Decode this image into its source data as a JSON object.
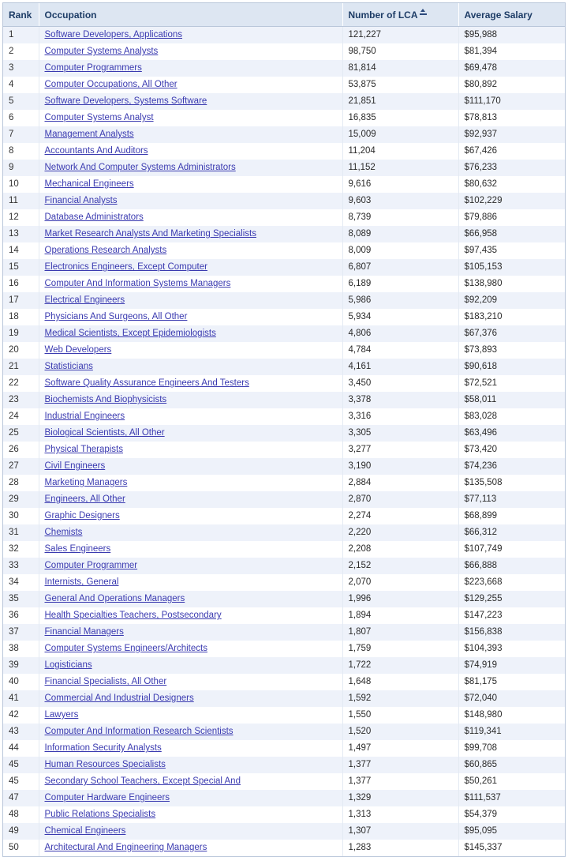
{
  "table": {
    "columns": [
      {
        "key": "rank",
        "label": "Rank",
        "sort_icon": null
      },
      {
        "key": "occ",
        "label": "Occupation",
        "sort_icon": null
      },
      {
        "key": "lca",
        "label": "Number of LCA",
        "sort_icon": "sort-ascending-icon"
      },
      {
        "key": "salary",
        "label": "Average Salary",
        "sort_icon": null
      }
    ],
    "sorted_by": "Number of LCA",
    "sort_direction": "descending",
    "colors": {
      "header_background": "#dde6f2",
      "header_text": "#1d3c66",
      "row_odd_background": "#eef2fa",
      "row_even_background": "#ffffff",
      "link": "#3a3ab0",
      "border": "#b9c6da"
    },
    "rows": [
      {
        "rank": "1",
        "occupation": "Software Developers, Applications",
        "lca": "121,227",
        "salary": "$95,988"
      },
      {
        "rank": "2",
        "occupation": "Computer Systems Analysts",
        "lca": "98,750",
        "salary": "$81,394"
      },
      {
        "rank": "3",
        "occupation": "Computer Programmers",
        "lca": "81,814",
        "salary": "$69,478"
      },
      {
        "rank": "4",
        "occupation": "Computer Occupations, All Other",
        "lca": "53,875",
        "salary": "$80,892"
      },
      {
        "rank": "5",
        "occupation": "Software Developers, Systems Software",
        "lca": "21,851",
        "salary": "$111,170"
      },
      {
        "rank": "6",
        "occupation": "Computer Systems Analyst",
        "lca": "16,835",
        "salary": "$78,813"
      },
      {
        "rank": "7",
        "occupation": "Management Analysts",
        "lca": "15,009",
        "salary": "$92,937"
      },
      {
        "rank": "8",
        "occupation": "Accountants And Auditors",
        "lca": "11,204",
        "salary": "$67,426"
      },
      {
        "rank": "9",
        "occupation": "Network And Computer Systems Administrators",
        "lca": "11,152",
        "salary": "$76,233"
      },
      {
        "rank": "10",
        "occupation": "Mechanical Engineers",
        "lca": "9,616",
        "salary": "$80,632"
      },
      {
        "rank": "11",
        "occupation": "Financial Analysts",
        "lca": "9,603",
        "salary": "$102,229"
      },
      {
        "rank": "12",
        "occupation": "Database Administrators",
        "lca": "8,739",
        "salary": "$79,886"
      },
      {
        "rank": "13",
        "occupation": "Market Research Analysts And Marketing Specialists",
        "lca": "8,089",
        "salary": "$66,958"
      },
      {
        "rank": "14",
        "occupation": "Operations Research Analysts",
        "lca": "8,009",
        "salary": "$97,435"
      },
      {
        "rank": "15",
        "occupation": "Electronics Engineers, Except Computer",
        "lca": "6,807",
        "salary": "$105,153"
      },
      {
        "rank": "16",
        "occupation": "Computer And Information Systems Managers",
        "lca": "6,189",
        "salary": "$138,980"
      },
      {
        "rank": "17",
        "occupation": "Electrical Engineers",
        "lca": "5,986",
        "salary": "$92,209"
      },
      {
        "rank": "18",
        "occupation": "Physicians And Surgeons, All Other",
        "lca": "5,934",
        "salary": "$183,210"
      },
      {
        "rank": "19",
        "occupation": "Medical Scientists, Except Epidemiologists",
        "lca": "4,806",
        "salary": "$67,376"
      },
      {
        "rank": "20",
        "occupation": "Web Developers",
        "lca": "4,784",
        "salary": "$73,893"
      },
      {
        "rank": "21",
        "occupation": "Statisticians",
        "lca": "4,161",
        "salary": "$90,618"
      },
      {
        "rank": "22",
        "occupation": "Software Quality Assurance Engineers And Testers",
        "lca": "3,450",
        "salary": "$72,521"
      },
      {
        "rank": "23",
        "occupation": "Biochemists And Biophysicists",
        "lca": "3,378",
        "salary": "$58,011"
      },
      {
        "rank": "24",
        "occupation": "Industrial Engineers",
        "lca": "3,316",
        "salary": "$83,028"
      },
      {
        "rank": "25",
        "occupation": "Biological Scientists, All Other",
        "lca": "3,305",
        "salary": "$63,496"
      },
      {
        "rank": "26",
        "occupation": "Physical Therapists",
        "lca": "3,277",
        "salary": "$73,420"
      },
      {
        "rank": "27",
        "occupation": "Civil Engineers",
        "lca": "3,190",
        "salary": "$74,236"
      },
      {
        "rank": "28",
        "occupation": "Marketing Managers",
        "lca": "2,884",
        "salary": "$135,508"
      },
      {
        "rank": "29",
        "occupation": "Engineers, All Other",
        "lca": "2,870",
        "salary": "$77,113"
      },
      {
        "rank": "30",
        "occupation": "Graphic Designers",
        "lca": "2,274",
        "salary": "$68,899"
      },
      {
        "rank": "31",
        "occupation": "Chemists",
        "lca": "2,220",
        "salary": "$66,312"
      },
      {
        "rank": "32",
        "occupation": "Sales Engineers",
        "lca": "2,208",
        "salary": "$107,749"
      },
      {
        "rank": "33",
        "occupation": "Computer Programmer",
        "lca": "2,152",
        "salary": "$66,888"
      },
      {
        "rank": "34",
        "occupation": "Internists, General",
        "lca": "2,070",
        "salary": "$223,668"
      },
      {
        "rank": "35",
        "occupation": "General And Operations Managers",
        "lca": "1,996",
        "salary": "$129,255"
      },
      {
        "rank": "36",
        "occupation": "Health Specialties Teachers, Postsecondary",
        "lca": "1,894",
        "salary": "$147,223"
      },
      {
        "rank": "37",
        "occupation": "Financial Managers",
        "lca": "1,807",
        "salary": "$156,838"
      },
      {
        "rank": "38",
        "occupation": "Computer Systems Engineers/Architects",
        "lca": "1,759",
        "salary": "$104,393"
      },
      {
        "rank": "39",
        "occupation": "Logisticians",
        "lca": "1,722",
        "salary": "$74,919"
      },
      {
        "rank": "40",
        "occupation": "Financial Specialists, All Other",
        "lca": "1,648",
        "salary": "$81,175"
      },
      {
        "rank": "41",
        "occupation": "Commercial And Industrial Designers",
        "lca": "1,592",
        "salary": "$72,040"
      },
      {
        "rank": "42",
        "occupation": "Lawyers",
        "lca": "1,550",
        "salary": "$148,980"
      },
      {
        "rank": "43",
        "occupation": "Computer And Information Research Scientists",
        "lca": "1,520",
        "salary": "$119,341"
      },
      {
        "rank": "44",
        "occupation": "Information Security Analysts",
        "lca": "1,497",
        "salary": "$99,708"
      },
      {
        "rank": "45",
        "occupation": "Human Resources Specialists",
        "lca": "1,377",
        "salary": "$60,865"
      },
      {
        "rank": "45",
        "occupation": "Secondary School Teachers, Except Special And",
        "lca": "1,377",
        "salary": "$50,261"
      },
      {
        "rank": "47",
        "occupation": "Computer Hardware Engineers",
        "lca": "1,329",
        "salary": "$111,537"
      },
      {
        "rank": "48",
        "occupation": "Public Relations Specialists",
        "lca": "1,313",
        "salary": "$54,379"
      },
      {
        "rank": "49",
        "occupation": "Chemical Engineers",
        "lca": "1,307",
        "salary": "$95,095"
      },
      {
        "rank": "50",
        "occupation": "Architectural And Engineering Managers",
        "lca": "1,283",
        "salary": "$145,337"
      }
    ]
  }
}
